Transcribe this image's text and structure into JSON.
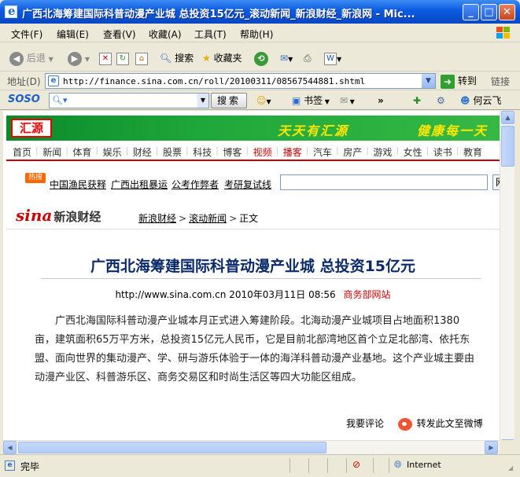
{
  "window": {
    "title": "广西北海筹建国际科普动漫产业城 总投资15亿元_滚动新闻_新浪财经_新浪网 - Mic...",
    "min": "_",
    "max": "□",
    "close": "✕"
  },
  "menu": [
    "文件(F)",
    "编辑(E)",
    "查看(V)",
    "收藏(A)",
    "工具(T)",
    "帮助(H)"
  ],
  "toolbar": {
    "back": "后退",
    "search": "搜索",
    "favorites": "收藏夹"
  },
  "address": {
    "label": "地址(D)",
    "url": "http://finance.sina.com.cn/roll/20100311/08567544881.shtml",
    "go": "转到",
    "links": "链接"
  },
  "soso": {
    "logo": "SOSO",
    "search_btn": "搜索",
    "bookmarks": "书签",
    "user": "何云飞"
  },
  "banner": {
    "logo": "汇源",
    "slogan1": "天天有汇源",
    "slogan2": "健康每一天"
  },
  "channels": [
    {
      "label": "首页",
      "hot": false
    },
    {
      "label": "新闻",
      "hot": false
    },
    {
      "label": "体育",
      "hot": false
    },
    {
      "label": "娱乐",
      "hot": false
    },
    {
      "label": "财经",
      "hot": false
    },
    {
      "label": "股票",
      "hot": false
    },
    {
      "label": "科技",
      "hot": false
    },
    {
      "label": "博客",
      "hot": false
    },
    {
      "label": "视频",
      "hot": true
    },
    {
      "label": "播客",
      "hot": true
    },
    {
      "label": "汽车",
      "hot": false
    },
    {
      "label": "房产",
      "hot": false
    },
    {
      "label": "游戏",
      "hot": false
    },
    {
      "label": "女性",
      "hot": false
    },
    {
      "label": "读书",
      "hot": false
    },
    {
      "label": "教育",
      "hot": false
    }
  ],
  "hot": {
    "badge": "热搜",
    "links": [
      "中国渔民获释",
      "广西出租暴运",
      "公考作弊者",
      "考研复试线"
    ],
    "button": "网"
  },
  "breadcrumb": {
    "brand": "sina",
    "brand_suffix": "新浪财经",
    "items": [
      "新浪财经",
      "滚动新闻",
      "正文"
    ]
  },
  "article": {
    "title": "广西北海筹建国际科普动漫产业城 总投资15亿元",
    "url": "http://www.sina.com.cn",
    "date": "2010年03月11日 08:56",
    "source": "商务部网站",
    "body": "广西北海国际科普动漫产业城本月正式进入筹建阶段。北海动漫产业城项目占地面积1380亩，建筑面积65万平方米，总投资15亿元人民币，它是目前北部湾地区首个立足北部湾、依托东盟、面向世界的集动漫产、学、研与游乐体验于一体的海洋科普动漫产业基地。这个产业城主要由动漫产业区、科普游乐区、商务交易区和时尚生活区等四大功能区组成。",
    "comment": "我要评论",
    "share": "转发此文至微博"
  },
  "status": {
    "text": "完毕",
    "zone": "Internet"
  }
}
